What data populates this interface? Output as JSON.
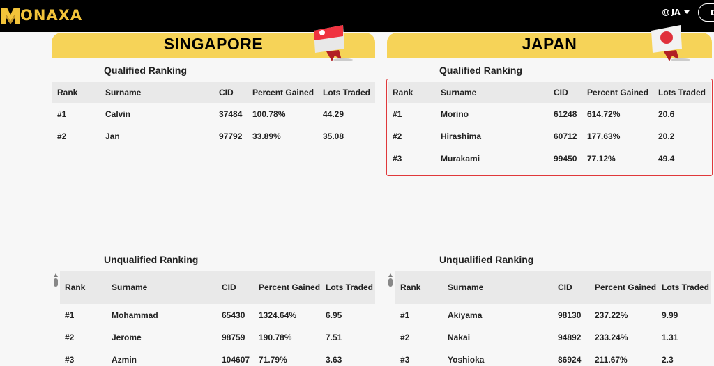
{
  "header": {
    "logo_text": "ONAXA",
    "language": "JA",
    "button_initial": "D"
  },
  "singapore": {
    "country": "SINGAPORE",
    "qualified": {
      "title": "Qualified Ranking",
      "columns": [
        "Rank",
        "Surname",
        "CID",
        "Percent Gained",
        "Lots Traded"
      ],
      "rows": [
        [
          "#1",
          "Calvin",
          "37484",
          "100.78%",
          "44.29"
        ],
        [
          "#2",
          "Jan",
          "97792",
          "33.89%",
          "35.08"
        ]
      ]
    },
    "unqualified": {
      "title": "Unqualified Ranking",
      "columns": [
        "Rank",
        "Surname",
        "CID",
        "Percent Gained",
        "Lots Traded"
      ],
      "rows": [
        [
          "#1",
          "Mohammad",
          "65430",
          "1324.64%",
          "6.95"
        ],
        [
          "#2",
          "Jerome",
          "98759",
          "190.78%",
          "7.51"
        ],
        [
          "#3",
          "Azmin",
          "104607",
          "71.79%",
          "3.63"
        ]
      ]
    }
  },
  "japan": {
    "country": "JAPAN",
    "qualified": {
      "title": "Qualified Ranking",
      "columns": [
        "Rank",
        "Surname",
        "CID",
        "Percent Gained",
        "Lots Traded"
      ],
      "rows": [
        [
          "#1",
          "Morino",
          "61248",
          "614.72%",
          "20.6"
        ],
        [
          "#2",
          "Hirashima",
          "60712",
          "177.63%",
          "20.2"
        ],
        [
          "#3",
          "Murakami",
          "99450",
          "77.12%",
          "49.4"
        ]
      ]
    },
    "unqualified": {
      "title": "Unqualified Ranking",
      "columns": [
        "Rank",
        "Surname",
        "CID",
        "Percent Gained",
        "Lots Traded"
      ],
      "rows": [
        [
          "#1",
          "Akiyama",
          "98130",
          "237.22%",
          "9.99"
        ],
        [
          "#2",
          "Nakai",
          "94892",
          "233.24%",
          "1.31"
        ],
        [
          "#3",
          "Yoshioka",
          "86924",
          "211.67%",
          "2.3"
        ]
      ]
    }
  },
  "colors": {
    "brand_yellow": "#f6d358",
    "logo_gold": "#f2c33a",
    "highlight_red": "#e0383b"
  }
}
